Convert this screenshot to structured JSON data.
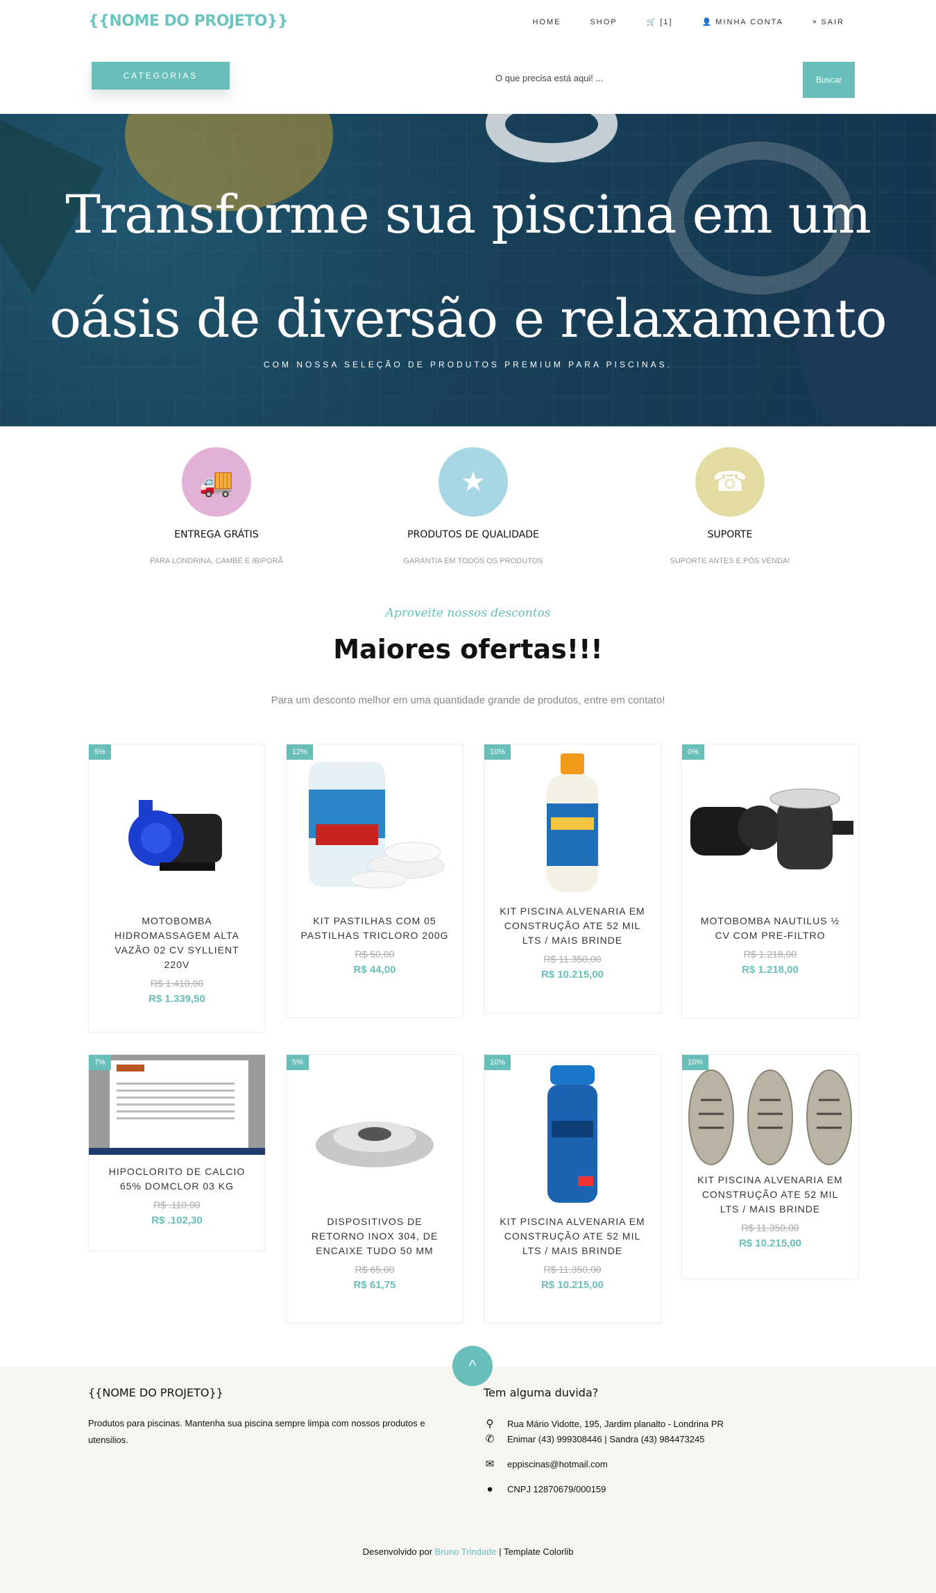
{
  "header": {
    "logo": "{{NOME DO PROJETO}}",
    "nav": [
      {
        "label": "HOME",
        "icon": ""
      },
      {
        "label": "SHOP",
        "icon": ""
      },
      {
        "label": "[1]",
        "icon": "🛒"
      },
      {
        "label": "MINHA CONTA",
        "icon": "👤"
      },
      {
        "label": "SAIR",
        "icon": "×"
      }
    ],
    "categories_label": "CATEGORIAS",
    "search_placeholder": "O que precisa está aqui! ...",
    "search_button": "Buscar"
  },
  "hero": {
    "line1": "Transforme sua piscina em um",
    "line2": "oásis de diversão e relaxamento",
    "subtitle": "COM NOSSA SELEÇÃO DE PRODUTOS PREMIUM PARA PISCINAS."
  },
  "features": [
    {
      "title": "ENTREGA GRÁTIS",
      "desc": "PARA LONDRINA, CAMBÉ E IBIPORÃ",
      "icon": "truck-icon",
      "color": "#e3b1d5",
      "glyph": "🚚"
    },
    {
      "title": "PRODUTOS DE QUALIDADE",
      "desc": "GARANTIA EM TODOS OS PRODUTOS",
      "icon": "badge-icon",
      "color": "#a7d6e4",
      "glyph": "★"
    },
    {
      "title": "SUPORTE",
      "desc": "SUPORTE ANTES E PÓS VENDA!",
      "icon": "support-icon",
      "color": "#e2dca2",
      "glyph": "☎"
    }
  ],
  "offers": {
    "eyebrow": "Aproveite nossos descontos",
    "title": "Maiores ofertas!!!",
    "lead": "Para um desconto melhor em uma quantidade grande de produtos, entre em contato!"
  },
  "products": [
    {
      "badge": "5%",
      "name": "MOTOBOMBA HIDROMASSAGEM ALTA VAZÃO 02 CV SYLLIENT 220V",
      "old": "R$ 1.410,00",
      "price": "R$ 1.339,50",
      "image": "pump-blue-icon"
    },
    {
      "badge": "12%",
      "name": "KIT PASTILHAS COM 05 PASTILHAS TRICLORO 200G",
      "old": "R$ 50,00",
      "price": "R$ 44,00",
      "image": "tablets-jar-icon"
    },
    {
      "badge": "10%",
      "name": "KIT PISCINA ALVENARIA EM CONSTRUÇÃO ATE 52 MIL LTS / MAIS BRINDE",
      "old": "R$ 11.350,00",
      "price": "R$ 10.215,00",
      "image": "bottle-icon"
    },
    {
      "badge": "0%",
      "name": "MOTOBOMBA NAUTILUS ½ CV COM PRE-FILTRO",
      "old": "R$ 1.218,00",
      "price": "R$ 1.218,00",
      "image": "pump-black-icon"
    },
    {
      "badge": "7%",
      "name": "HIPOCLORITO DE CALCIO 65% DOMCLOR 03 KG",
      "old": "R$ .110,00",
      "price": "R$ .102,30",
      "image": "screenshot-doc-icon"
    },
    {
      "badge": "5%",
      "name": "DISPOSITIVOS DE RETORNO INOX 304, DE ENCAIXE TUDO 50 MM",
      "old": "R$ 65,00",
      "price": "R$ 61,75",
      "image": "return-fitting-icon"
    },
    {
      "badge": "10%",
      "name": "KIT PISCINA ALVENARIA EM CONSTRUÇÃO ATE 52 MIL LTS / MAIS BRINDE",
      "old": "R$ 11.350,00",
      "price": "R$ 10.215,00",
      "image": "test-kit-icon"
    },
    {
      "badge": "10%",
      "name": "KIT PISCINA ALVENARIA EM CONSTRUÇÃO ATE 52 MIL LTS / MAIS BRINDE",
      "old": "R$ 11.350,00",
      "price": "R$ 10.215,00",
      "image": "drain-covers-icon"
    }
  ],
  "footer": {
    "brand": "{{NOME DO PROJETO}}",
    "about": "Produtos para piscinas. Mantenha sua piscina sempre limpa com nossos produtos e utensilios.",
    "contact_title": "Tem alguma duvida?",
    "address": "Rua Mário Vidotte, 195, Jardim planalto - Londrina PR",
    "phones": "Enimar (43) 999308446 | Sandra (43) 984473245",
    "email": "eppiscinas@hotmail.com",
    "cnpj": "CNPJ 12870679/000159",
    "credit_prefix": "Desenvolvido por",
    "credit_author": "Bruno Trindade",
    "credit_suffix": "| Template Colorlib",
    "back_to_top": "^"
  },
  "colors": {
    "accent": "#68bfb9"
  }
}
